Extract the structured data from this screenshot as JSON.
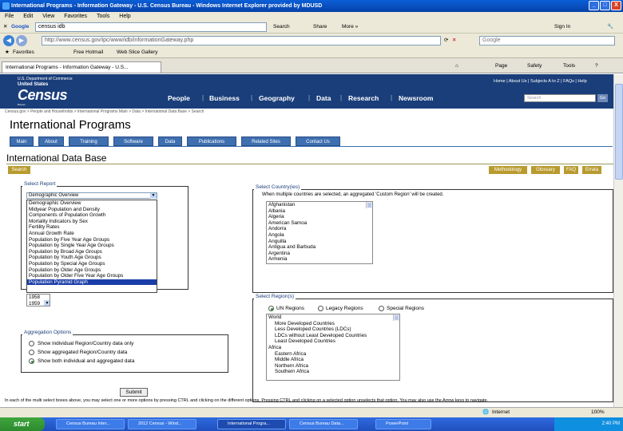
{
  "window": {
    "title": "International Programs - Information Gateway - U.S. Census Bureau - Windows Internet Explorer provided by MDUSD",
    "controls": [
      "_",
      "□",
      "X"
    ]
  },
  "menu": [
    "File",
    "Edit",
    "View",
    "Favorites",
    "Tools",
    "Help"
  ],
  "google_toolbar": {
    "label": "Google",
    "query": "census idb",
    "search_label": "Search",
    "share_label": "Share",
    "more_label": "More »",
    "signin_label": "Sign In"
  },
  "address": {
    "url": "http://www.census.gov/ipc/www/idb/informationGateway.php",
    "search_placeholder": "Google"
  },
  "favorites": {
    "favorites_label": "Favorites",
    "links": [
      "Free Hotmail",
      "Web Slice Gallery"
    ]
  },
  "tab": {
    "title": "International Programs - Information Gateway - U.S...",
    "tools": [
      "Page",
      "Safety",
      "Tools"
    ]
  },
  "census": {
    "dept": "U.S. Department of Commerce",
    "logo_top": "United States",
    "logo_main": "Census",
    "logo_bottom": "Bureau",
    "nav": [
      "People",
      "Business",
      "Geography",
      "Data",
      "Research",
      "Newsroom"
    ],
    "toplinks": "Home  |  About Us  |  Subjects A to Z  |  FAQs  |  Help",
    "search_placeholder": "Search",
    "go_label": "Go",
    "breadcrumbs": "Census.gov > People and Households > International Programs Main > Data > International Data Base > Search"
  },
  "ip": {
    "title": "International Programs",
    "tabs": [
      "Main",
      "About",
      "Training",
      "Software",
      "Data",
      "Publications",
      "Related Sites",
      "Contact Us"
    ]
  },
  "idb": {
    "title": "International Data Base",
    "search_tab": "Search",
    "right_tabs": [
      "Methodology",
      "Glossary",
      "FAQ",
      "Errata"
    ]
  },
  "report": {
    "label": "Select Report",
    "selected": "Demographic Overview",
    "options": [
      "Demographic Overview",
      "Midyear Population and Density",
      "Components of Population Growth",
      "Mortality Indicators by Sex",
      "Fertility Rates",
      "Annual Growth Rate",
      "Population by Five Year Age Groups",
      "Population by Single Year Age Groups",
      "Population by Broad Age Groups",
      "Population by Youth Age Groups",
      "Population by Special Age Groups",
      "Population by Older Age Groups",
      "Population by Older Five Year Age Groups",
      "Population Pyramid Graph"
    ],
    "highlighted_option": "Population Pyramid Graph",
    "year_options": [
      "1958",
      "1959"
    ]
  },
  "aggregation": {
    "label": "Aggregation Options",
    "options": [
      "Show individual Region/Country data only",
      "Show aggregated Region/Country data",
      "Show both individual and aggregated data"
    ],
    "selected_index": 2
  },
  "country": {
    "label": "Select Country(ies)",
    "note": "When multiple countries are selected, an aggregated 'Custom Region' will be created.",
    "items": [
      "Afghanistan",
      "Albania",
      "Algeria",
      "American Samoa",
      "Andorra",
      "Angola",
      "Anguilla",
      "Antigua and Barbuda",
      "Argentina",
      "Armenia"
    ]
  },
  "region": {
    "label": "Select Region(s)",
    "radios": [
      "UN Regions",
      "Legacy Regions",
      "Special Regions"
    ],
    "selected_index": 0,
    "items": [
      "World",
      "More Developed Countries",
      "Less Developed Countries (LDCs)",
      "LDCs without Least Developed Countries",
      "Least Developed Countries",
      "Africa",
      "Eastern Africa",
      "Middle Africa",
      "Northern Africa",
      "Southern Africa"
    ]
  },
  "submit_label": "Submit",
  "help_text": "In each of the multi select boxes above, you may select one or more options by pressing CTRL and clicking on the different options. Pressing CTRL and clicking on a selected option unselects that option. You may also use the Arrow keys to navigate.",
  "status": {
    "zone": "Internet",
    "zoom": "100%"
  },
  "taskbar": {
    "start": "start",
    "tasks": [
      "Census Bureau Inter...",
      "2012 Census - Wind...",
      "International Progra...",
      "Census Bureau Data...",
      "PowerPoint"
    ],
    "active_index": 2,
    "clock": "2:40 PM"
  }
}
